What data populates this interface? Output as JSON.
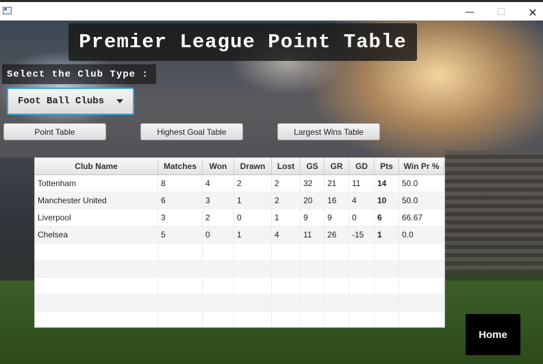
{
  "window": {
    "controls": [
      "—",
      "☐",
      "✕"
    ]
  },
  "header": {
    "title": "Premier League Point Table"
  },
  "club_select": {
    "label": "Select the Club Type :",
    "selected_value": "Foot Ball Clubs"
  },
  "buttons": {
    "point_table": "Point Table",
    "highest_goal_table": "Highest Goal Table",
    "largest_wins_table": "Largest Wins Table",
    "home": "Home"
  },
  "table": {
    "columns": [
      "Club Name",
      "Matches",
      "Won",
      "Drawn",
      "Lost",
      "GS",
      "GR",
      "GD",
      "Pts",
      "Win Pr %"
    ],
    "rows": [
      [
        "Tottenham",
        "8",
        "4",
        "2",
        "2",
        "32",
        "21",
        "11",
        "14",
        "50.0"
      ],
      [
        "Manchester United",
        "6",
        "3",
        "1",
        "2",
        "20",
        "16",
        "4",
        "10",
        "50.0"
      ],
      [
        "Liverpool",
        "3",
        "2",
        "0",
        "1",
        "9",
        "9",
        "0",
        "6",
        "66.67"
      ],
      [
        "Chelsea",
        "5",
        "0",
        "1",
        "4",
        "11",
        "26",
        "-15",
        "1",
        "0.0"
      ]
    ]
  },
  "colors": {
    "focus_border": "#39a4dc",
    "title_bg": "#191919",
    "home_bg": "#000000"
  }
}
